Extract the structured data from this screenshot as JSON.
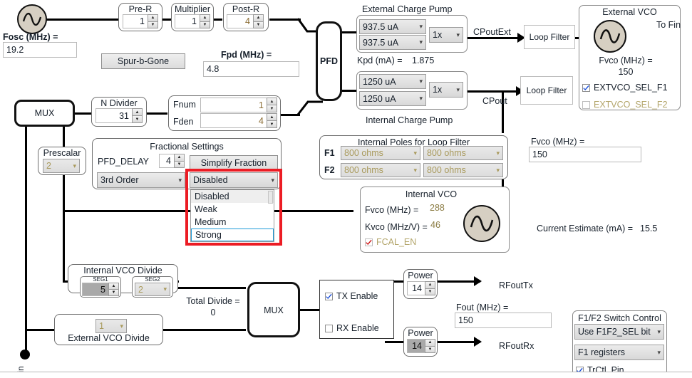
{
  "source": {
    "fosc_label": "Fosc (MHz) =",
    "fosc_value": "19.2",
    "osc_icon": "sine-oscillator-icon"
  },
  "ref_chain": {
    "pre_r": {
      "title": "Pre-R",
      "value": "1"
    },
    "multiplier": {
      "title": "Multiplier",
      "value": "1"
    },
    "post_r": {
      "title": "Post-R",
      "value": "4"
    }
  },
  "spur": {
    "button_label": "Spur-b-Gone"
  },
  "fpd": {
    "label": "Fpd (MHz) =",
    "value": "4.8"
  },
  "pfd": {
    "label": "PFD"
  },
  "feedback": {
    "mux_label": "MUX",
    "prescalar": {
      "title": "Prescalar",
      "value": "2",
      "enabled": false
    },
    "n_divider": {
      "title": "N Divider",
      "value": "31"
    },
    "fnum": {
      "label": "Fnum",
      "value": "1"
    },
    "fden": {
      "label": "Fden",
      "value": "4"
    }
  },
  "fractional": {
    "title": "Fractional Settings",
    "pfd_delay_label": "PFD_DELAY",
    "pfd_delay_value": "4",
    "simplify_button": "Simplify Fraction",
    "order_selected": "3rd Order",
    "dither_selected": "Disabled",
    "dither_options": [
      "Disabled",
      "Weak",
      "Medium",
      "Strong"
    ],
    "dither_hover": "Disabled",
    "dither_focus": "Strong",
    "highlight_color": "#ec1c24",
    "focus_color": "#1e9bd8"
  },
  "external_cp": {
    "title": "External Charge Pump",
    "up_current": "937.5 uA",
    "down_current": "937.5 uA",
    "gain": "1x",
    "kpd_label": "Kpd (mA) =",
    "kpd_value": "1.875",
    "out_label": "CPoutExt"
  },
  "internal_cp": {
    "title": "Internal Charge Pump",
    "up_current": "1250 uA",
    "down_current": "1250 uA",
    "gain": "1x",
    "out_label": "CPout"
  },
  "loop_filters": {
    "external_label": "Loop Filter",
    "internal_label": "Loop Filter"
  },
  "external_vco": {
    "title": "External VCO",
    "to_fin_label": "To Fin",
    "fvco_label": "Fvco (MHz) =",
    "fvco_value": "150",
    "sel_f1": {
      "label": "EXTVCO_SEL_F1",
      "checked": true,
      "enabled": true
    },
    "sel_f2": {
      "label": "EXTVCO_SEL_F2",
      "checked": false,
      "enabled": false
    }
  },
  "internal_poles": {
    "title": "Internal Poles for Loop Filter",
    "rows": [
      {
        "name": "F1",
        "r1": "800 ohms",
        "r2": "800 ohms"
      },
      {
        "name": "F2",
        "r1": "800 ohms",
        "r2": "800 ohms"
      }
    ]
  },
  "internal_vco": {
    "title": "Internal VCO",
    "fvco_label": "Fvco (MHz) =",
    "fvco_value": "288",
    "kvco_label": "Kvco (MHz/V) =",
    "kvco_value": "46",
    "fcal_en": {
      "label": "FCAL_EN",
      "checked": true,
      "enabled": false
    }
  },
  "readouts": {
    "fvco_label": "Fvco (MHz) =",
    "fvco_value": "150",
    "current_estimate_label": "Current Estimate (mA) =",
    "current_estimate_value": "15.5",
    "total_divide_label": "Total Divide =",
    "total_divide_value": "0",
    "fout_label": "Fout (MHz) =",
    "fout_value": "150"
  },
  "vco_divide": {
    "internal_title": "Internal VCO Divide",
    "seg1_label": "SEG1",
    "seg1_value": "5",
    "seg2_label": "SEG2",
    "seg2_value": "2",
    "external_title": "External VCO Divide",
    "external_value": "1"
  },
  "output": {
    "mux_label": "MUX",
    "tx_enable": {
      "label": "TX Enable",
      "checked": true
    },
    "rx_enable": {
      "label": "RX Enable",
      "checked": false
    },
    "tx_power": {
      "title": "Power",
      "value": "14"
    },
    "rx_power": {
      "title": "Power",
      "value": "14"
    },
    "rfout_tx": "RFoutTx",
    "rfout_rx": "RFoutRx",
    "fin_label": "Fin"
  },
  "switch_control": {
    "title": "F1/F2 Switch Control",
    "mode": "Use F1F2_SEL bit",
    "registers": "F1 registers",
    "trctl_pin": {
      "label": "TrCtl_Pin",
      "checked": true
    }
  }
}
